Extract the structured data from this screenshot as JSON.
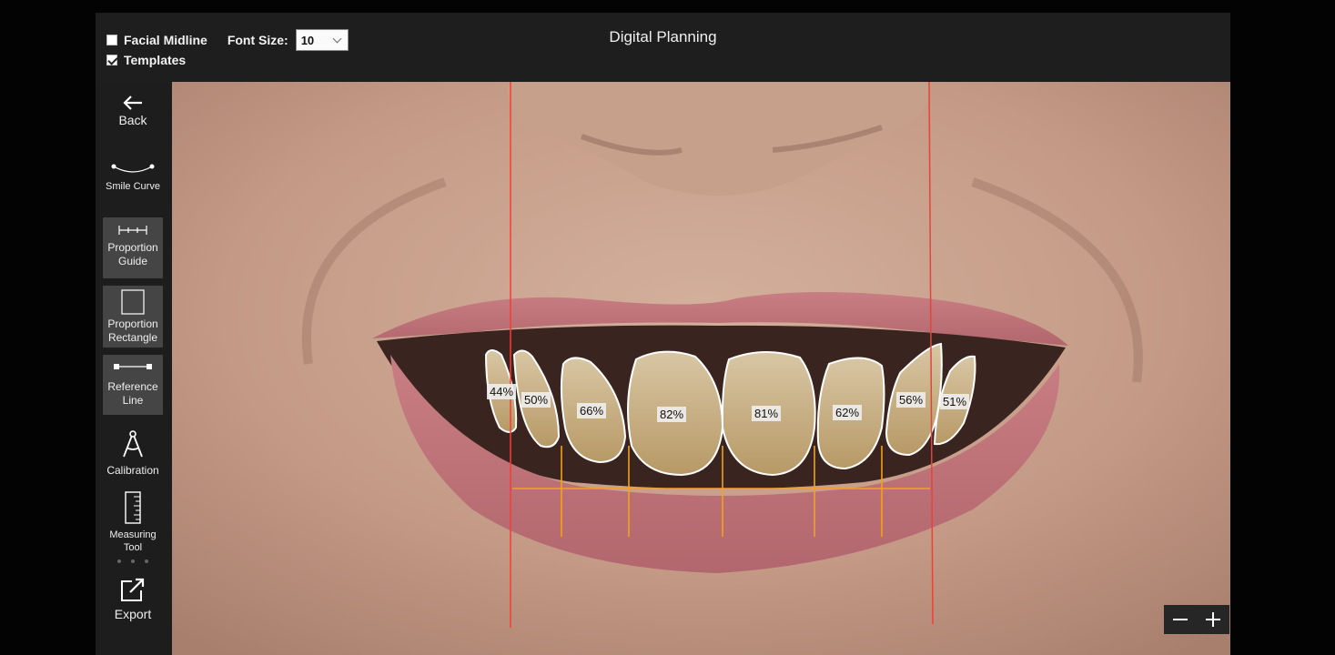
{
  "header": {
    "title": "Digital Planning",
    "facial_midline": {
      "label": "Facial Midline",
      "checked": false
    },
    "templates": {
      "label": "Templates",
      "checked": true
    },
    "font_size": {
      "label": "Font Size:",
      "value": "10"
    }
  },
  "sidebar": {
    "back": "Back",
    "smile_curve": "Smile Curve",
    "proportion_guide": [
      "Proportion",
      "Guide"
    ],
    "proportion_rectangle": [
      "Proportion",
      "Rectangle"
    ],
    "reference_line": [
      "Reference",
      "Line"
    ],
    "calibration": "Calibration",
    "measuring_tool": [
      "Measuring",
      "Tool"
    ],
    "export": "Export"
  },
  "teeth_percentages": [
    "44%",
    "50%",
    "66%",
    "82%",
    "81%",
    "62%",
    "56%",
    "51%"
  ],
  "zoom": {
    "minus_icon": "minus-icon",
    "plus_icon": "plus-icon"
  },
  "colors": {
    "guide_red": "#e8433a",
    "guide_orange": "#f2a21d",
    "outline": "#ffffff",
    "panel": "#1d1d1d",
    "tool_active": "#454545"
  }
}
